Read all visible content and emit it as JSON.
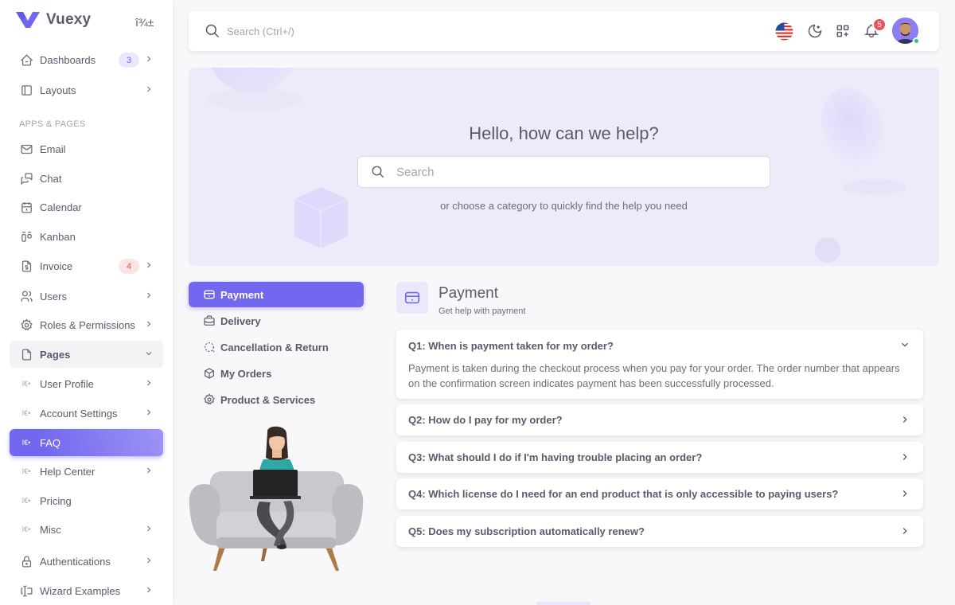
{
  "brand": {
    "name": "Vuexy",
    "toggle": "î¾±"
  },
  "sidebar": {
    "items": [
      {
        "label": "Dashboards",
        "badge": "3"
      },
      {
        "label": "Layouts"
      }
    ],
    "section_header": "APPS & PAGES",
    "apps": [
      {
        "label": "Email"
      },
      {
        "label": "Chat"
      },
      {
        "label": "Calendar"
      },
      {
        "label": "Kanban"
      },
      {
        "label": "Invoice",
        "badge": "4"
      },
      {
        "label": "Users"
      },
      {
        "label": "Roles & Permissions"
      },
      {
        "label": "Pages"
      },
      {
        "label": "User Profile"
      },
      {
        "label": "Account Settings"
      },
      {
        "label": "FAQ"
      },
      {
        "label": "Help Center"
      },
      {
        "label": "Pricing"
      },
      {
        "label": "Misc"
      },
      {
        "label": "Authentications"
      },
      {
        "label": "Wizard Examples"
      }
    ],
    "sub_bullet": "î€•"
  },
  "navbar": {
    "search_placeholder": "Search (Ctrl+/)",
    "notification_count": "5"
  },
  "hero": {
    "title": "Hello, how can we help?",
    "search_placeholder": "Search",
    "subtitle": "or choose a category to quickly find the help you need"
  },
  "faq_tabs": [
    {
      "label": "Payment"
    },
    {
      "label": "Delivery"
    },
    {
      "label": "Cancellation & Return"
    },
    {
      "label": "My Orders"
    },
    {
      "label": "Product & Services"
    }
  ],
  "faq": {
    "title": "Payment",
    "subtitle": "Get help with payment",
    "questions": [
      {
        "q": "Q1: When is payment taken for my order?",
        "a": "Payment is taken during the checkout process when you pay for your order. The order number that appears on the confirmation screen indicates payment has been successfully processed."
      },
      {
        "q": "Q2: How do I pay for my order?"
      },
      {
        "q": "Q3: What should I do if I'm having trouble placing an order?"
      },
      {
        "q": "Q4: Which license do I need for an end product that is only accessible to paying users?"
      },
      {
        "q": "Q5: Does my subscription automatically renew?"
      }
    ]
  },
  "colors": {
    "primary": "#7367f0",
    "danger": "#ea5455",
    "success": "#28c76f"
  }
}
